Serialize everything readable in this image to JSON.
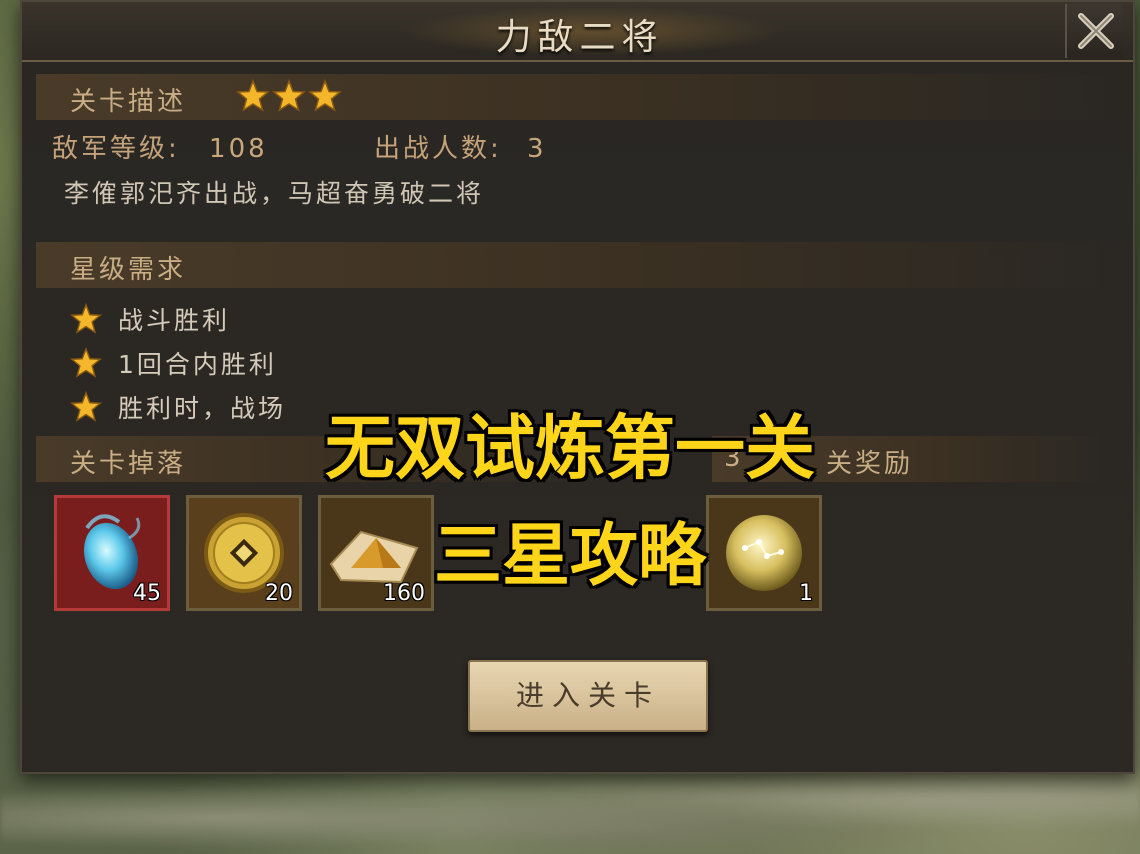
{
  "dialog": {
    "title": "力敌二将"
  },
  "stage_description": {
    "header": "关卡描述",
    "stars_earned": 3,
    "enemy_level_label": "敌军等级:",
    "enemy_level_value": "108",
    "battle_count_label": "出战人数:",
    "battle_count_value": "3",
    "description": "李傕郭汜齐出战，马超奋勇破二将"
  },
  "star_requirements": {
    "header": "星级需求",
    "items": [
      {
        "label": "战斗胜利"
      },
      {
        "label": "1回合内胜利"
      },
      {
        "label": "胜利时，战场"
      }
    ]
  },
  "stage_drops": {
    "header": "关卡掉落",
    "items": [
      {
        "icon": "blue-crystal-icon",
        "quantity": "45"
      },
      {
        "icon": "gold-coin-icon",
        "quantity": "20"
      },
      {
        "icon": "sand-pile-icon",
        "quantity": "160"
      }
    ]
  },
  "three_star_reward": {
    "header_visible": "3",
    "header_tail": "关奖励",
    "items": [
      {
        "icon": "gold-orb-icon",
        "quantity": "1"
      }
    ]
  },
  "enter_button": {
    "label": "进入关卡"
  },
  "overlay": {
    "line1": "无双试炼第一关",
    "line2": "三星攻略"
  },
  "colors": {
    "star": "#f4b62a",
    "overlay_text": "#ffd51a",
    "section_text": "#c8ad85"
  }
}
